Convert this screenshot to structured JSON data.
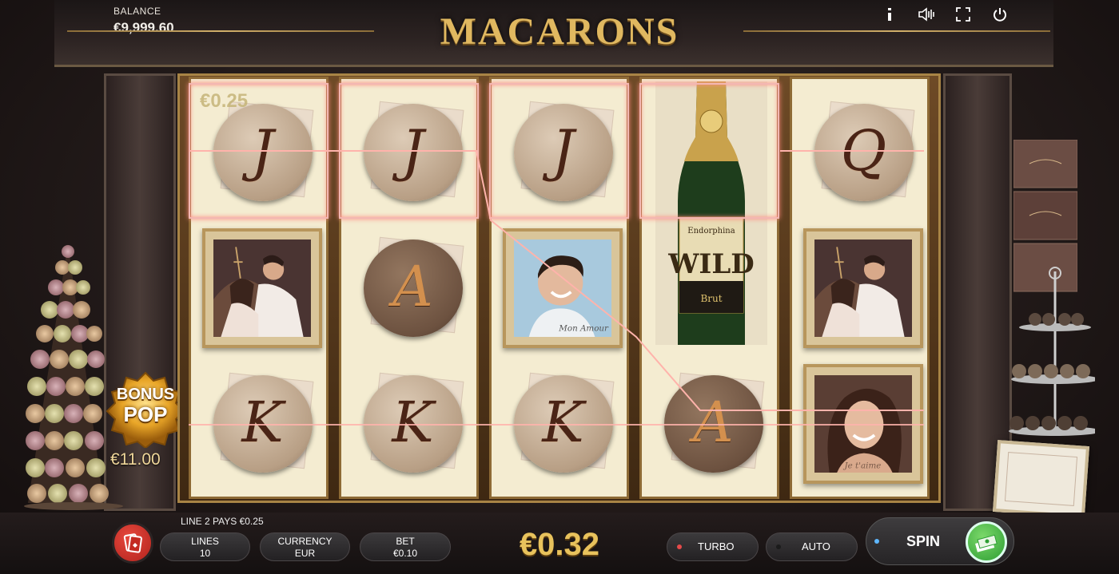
{
  "header": {
    "balance_label": "BALANCE",
    "balance_value": "€9,999.60",
    "game_title": "MACARONS",
    "icons": [
      "info-icon",
      "volume-icon",
      "fullscreen-icon",
      "power-icon"
    ]
  },
  "reels": {
    "win_amount": "€0.25",
    "columns": [
      [
        "macaron-J",
        "photo-couple",
        "macaron-K"
      ],
      [
        "macaron-J",
        "macaron-A",
        "macaron-K"
      ],
      [
        "macaron-J",
        "photo-man",
        "macaron-K"
      ],
      [
        "wild-bottle",
        "wild-bottle",
        "macaron-A"
      ],
      [
        "macaron-Q",
        "photo-couple",
        "photo-woman"
      ]
    ],
    "glyphs": {
      "J": "J",
      "A": "A",
      "K": "K",
      "Q": "Q"
    }
  },
  "bonus": {
    "line1": "BONUS",
    "line2": "POP",
    "amount": "€11.00"
  },
  "footer": {
    "line_info": "LINE 2 PAYS €0.25",
    "lines_label": "LINES",
    "lines_value": "10",
    "currency_label": "CURRENCY",
    "currency_value": "EUR",
    "bet_label": "BET",
    "bet_value": "€0.10",
    "win_total": "€0.32",
    "turbo_label": "TURBO",
    "auto_label": "AUTO",
    "spin_label": "SPIN"
  },
  "colors": {
    "accent_gold": "#e0b860",
    "turbo_dot": "#e64a4a",
    "auto_dot": "#2a2a2a",
    "spin_dot": "#5fb7ff",
    "payline": "#ffb3ab"
  }
}
